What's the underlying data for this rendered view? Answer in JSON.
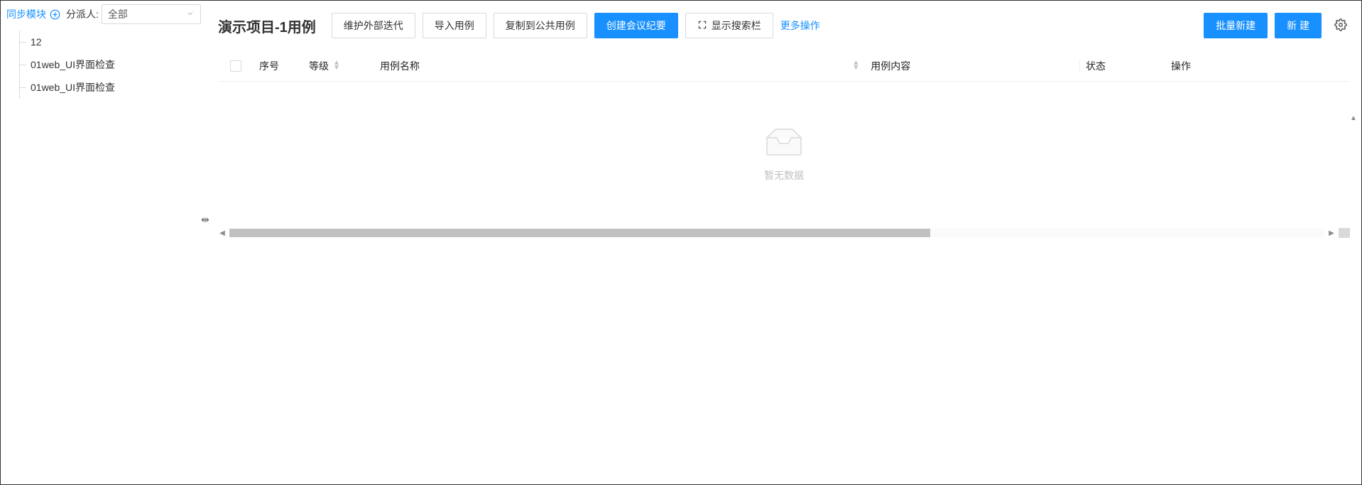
{
  "sidebar": {
    "sync_module_label": "同步模块",
    "assignee_label": "分派人:",
    "assignee_value": "全部",
    "tree": [
      {
        "label": "12"
      },
      {
        "label": "01web_UI界面检查"
      },
      {
        "label": "01web_UI界面检查"
      }
    ]
  },
  "toolbar": {
    "title": "演示项目-1用例",
    "btn_maintain": "维护外部迭代",
    "btn_import": "导入用例",
    "btn_copy_public": "复制到公共用例",
    "btn_create_meeting": "创建会议纪要",
    "btn_show_search": "显示搜索栏",
    "more": "更多操作",
    "btn_batch_new": "批量新建",
    "btn_new": "新 建"
  },
  "table": {
    "col_seq": "序号",
    "col_level": "等级",
    "col_name": "用例名称",
    "col_content": "用例内容",
    "col_status": "状态",
    "col_op": "操作",
    "empty_text": "暂无数据"
  }
}
